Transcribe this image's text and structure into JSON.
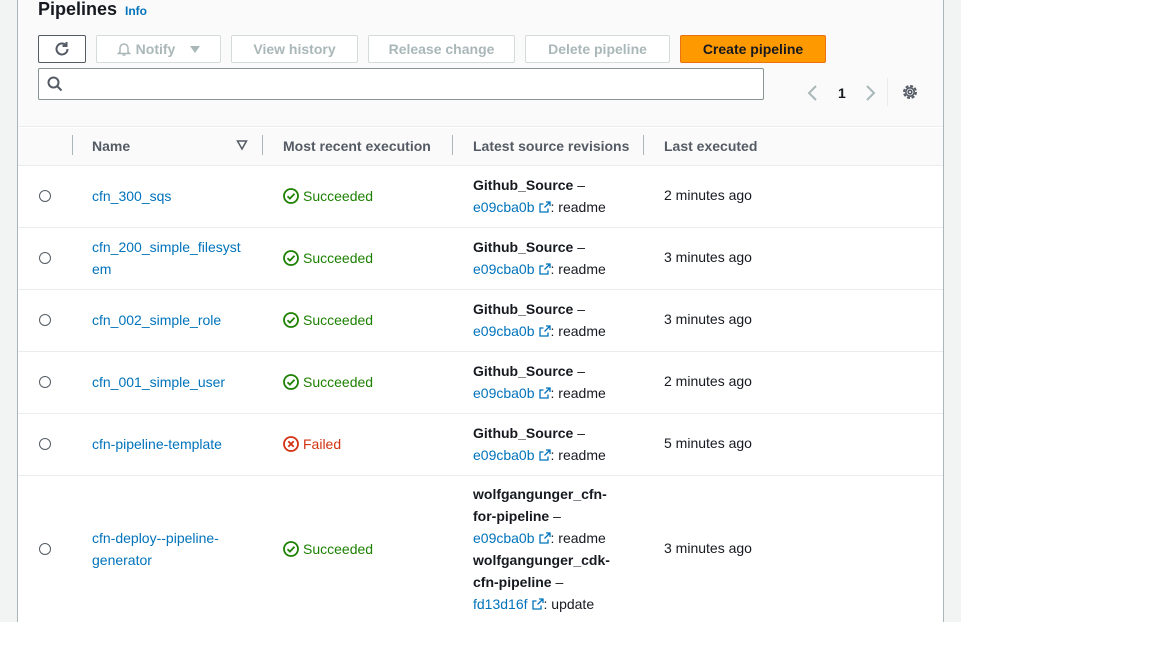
{
  "header": {
    "title": "Pipelines",
    "info": "Info"
  },
  "toolbar": {
    "notify": "Notify",
    "view_history": "View history",
    "release_change": "Release change",
    "delete_pipeline": "Delete pipeline",
    "create_pipeline": "Create pipeline"
  },
  "search": {
    "value": "",
    "placeholder": ""
  },
  "pagination": {
    "current_page": "1"
  },
  "table": {
    "columns": [
      "Name",
      "Most recent execution",
      "Latest source revisions",
      "Last executed"
    ],
    "rows": [
      {
        "name": "cfn_300_sqs",
        "status": "Succeeded",
        "sources": [
          {
            "source": "Github_Source",
            "revision": "e09cba0b",
            "message": "readme"
          }
        ],
        "last_executed": "2 minutes ago"
      },
      {
        "name": "cfn_200_simple_filesystem",
        "status": "Succeeded",
        "sources": [
          {
            "source": "Github_Source",
            "revision": "e09cba0b",
            "message": "readme"
          }
        ],
        "last_executed": "3 minutes ago"
      },
      {
        "name": "cfn_002_simple_role",
        "status": "Succeeded",
        "sources": [
          {
            "source": "Github_Source",
            "revision": "e09cba0b",
            "message": "readme"
          }
        ],
        "last_executed": "3 minutes ago"
      },
      {
        "name": "cfn_001_simple_user",
        "status": "Succeeded",
        "sources": [
          {
            "source": "Github_Source",
            "revision": "e09cba0b",
            "message": "readme"
          }
        ],
        "last_executed": "2 minutes ago"
      },
      {
        "name": "cfn-pipeline-template",
        "status": "Failed",
        "sources": [
          {
            "source": "Github_Source",
            "revision": "e09cba0b",
            "message": "readme"
          }
        ],
        "last_executed": "5 minutes ago"
      },
      {
        "name": "cfn-deploy--pipeline-generator",
        "status": "Succeeded",
        "sources": [
          {
            "source": "wolfgangunger_cfn-for-pipeline",
            "revision": "e09cba0b",
            "message": "readme"
          },
          {
            "source": "wolfgangunger_cdk-cfn-pipeline",
            "revision": "fd13d16f",
            "message": "update"
          }
        ],
        "last_executed": "3 minutes ago"
      }
    ]
  },
  "colors": {
    "accent": "#ff9900",
    "link": "#0073bb",
    "success": "#1d8102",
    "error": "#d13212"
  },
  "icons": {
    "refresh": "refresh-icon",
    "bell": "bell-icon",
    "caret": "caret-down-icon",
    "search": "search-icon",
    "prev": "chevron-left-icon",
    "next": "chevron-right-icon",
    "settings": "gear-icon",
    "sort": "sort-down-icon",
    "success": "check-circle-icon",
    "fail": "x-circle-icon",
    "external": "external-link-icon"
  }
}
